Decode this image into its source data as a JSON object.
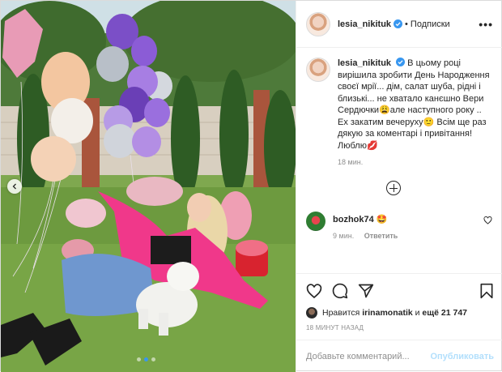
{
  "post": {
    "photo_alt": "",
    "carousel": {
      "slides": 3,
      "active": 1
    }
  },
  "header": {
    "username": "lesia_nikituk",
    "separator": "•",
    "follow_status": "Подписки",
    "more_icon": "more-dots-icon"
  },
  "caption": {
    "username": "lesia_nikituk",
    "text": "В цьому році вирішила зробити День Народження своєї мрії... дім, салат шуба, рідні і близькі... не хватало канєшно Вери Сердючки😩але наступного року .. Ех закатим вечеруху🙂 Всім ще раз дякую за коментарі і привітання! Люблю💋",
    "time": "18 мин."
  },
  "comments": [
    {
      "username": "bozhok74",
      "text": "🤩",
      "time": "9 мин.",
      "reply_label": "Ответить"
    }
  ],
  "likes": {
    "prefix": "Нравится",
    "user": "irinamonatik",
    "and": "и",
    "count": "ещё 21 747"
  },
  "timestamp": "18 МИНУТ НАЗАД",
  "add_comment": {
    "placeholder": "Добавьте комментарий...",
    "publish_label": "Опубликовать"
  },
  "colors": {
    "verified_blue": "#3897f0",
    "publish_disabled": "#b2dffc",
    "muted": "#8e8e8e"
  }
}
